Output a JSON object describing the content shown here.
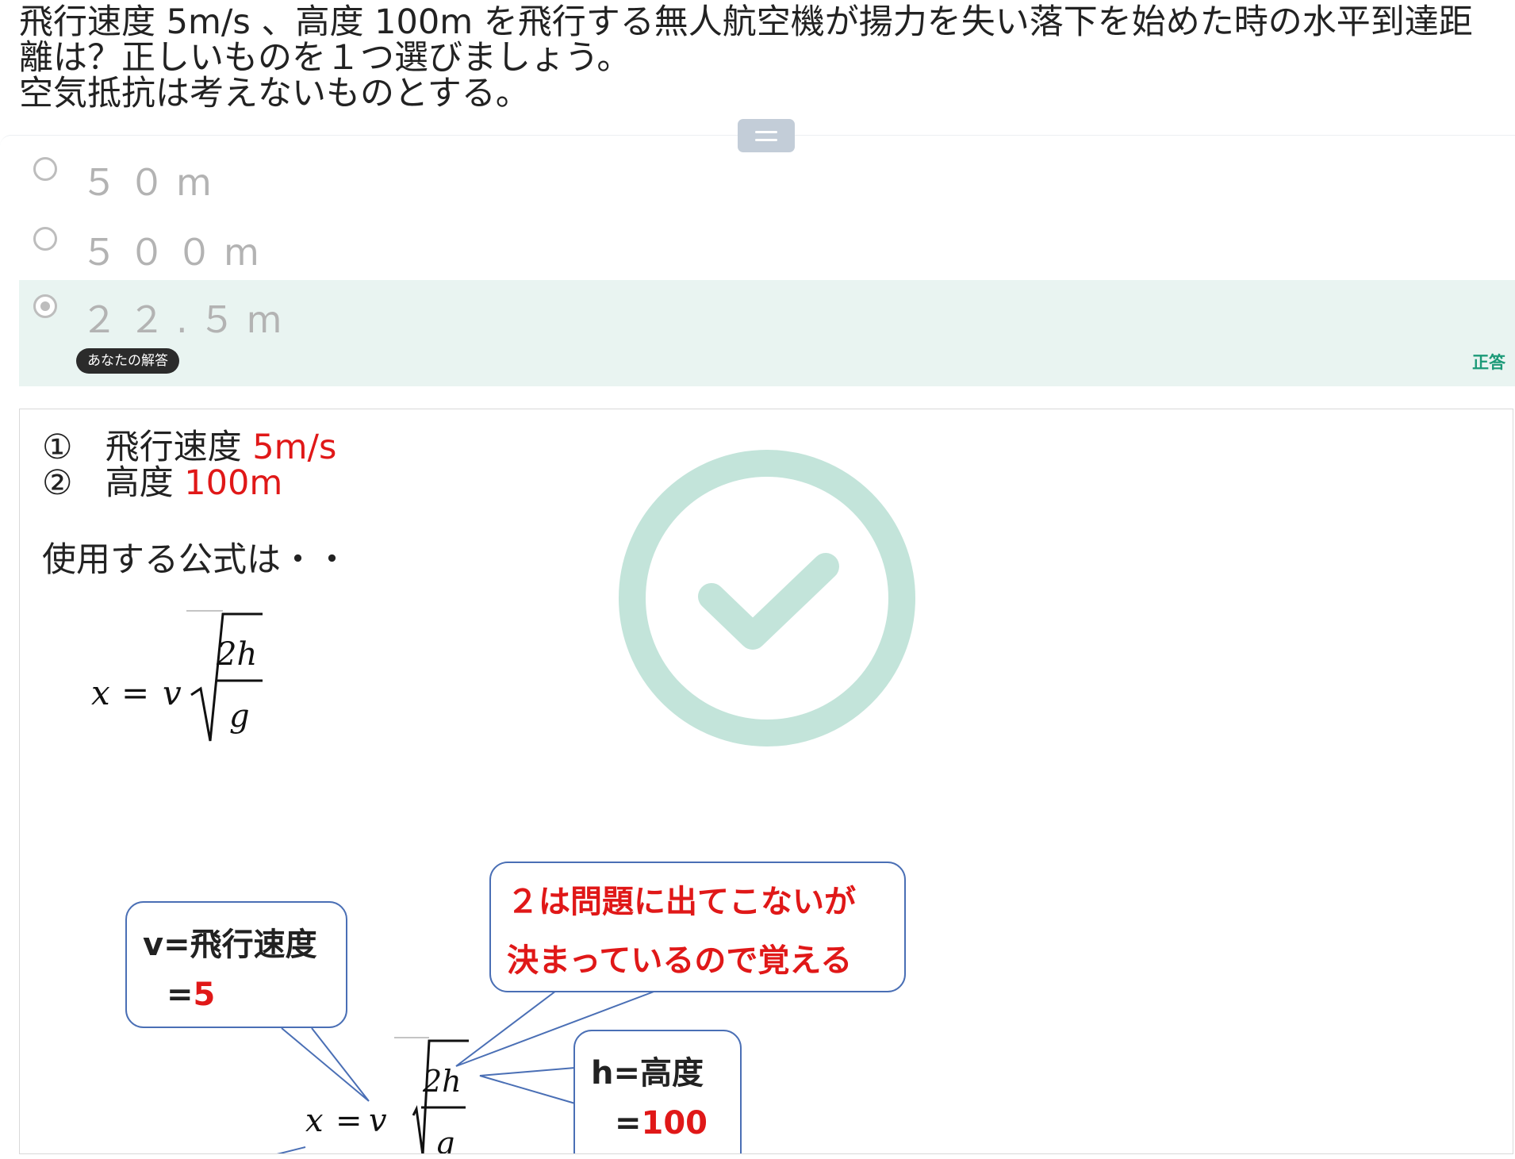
{
  "question": {
    "line1": "飛行速度 5m/s 、高度 100m を飛行する無人航空機が揚力を失い落下を始めた時の水平到達距",
    "line2": "離は？正しいものを１つ選びましょう。",
    "line3": "空気抵抗は考えないものとする。"
  },
  "options": [
    {
      "label": "５０m",
      "selected": false
    },
    {
      "label": "５００m",
      "selected": false
    },
    {
      "label": "２２.５m",
      "selected": true
    }
  ],
  "your_answer_badge": "あなたの解答",
  "correct_label": "正答",
  "explanation": {
    "given": [
      {
        "marker": "①",
        "label": "飛行速度 ",
        "value": "5m/s"
      },
      {
        "marker": "②",
        "label": "高度 ",
        "value": "100m"
      }
    ],
    "usage": "使用する公式は・・",
    "formula": {
      "lhs": "x",
      "eq": "=",
      "v": "v",
      "num": "2h",
      "den": "g"
    },
    "callout_v": {
      "line1": "v=飛行速度",
      "eq": "=",
      "value": "5"
    },
    "callout_2": {
      "line1": "２は問題に出てこないが",
      "line2": "決まっているので覚える"
    },
    "callout_h": {
      "line1": "h=高度",
      "eq": "=",
      "value": "100"
    }
  },
  "colors": {
    "accent_correct": "#1c9a78",
    "highlight": "#e01818",
    "selected_bg": "#e9f4f1",
    "check_circle": "#c3e4da",
    "callout_border": "#4a6fb5"
  }
}
